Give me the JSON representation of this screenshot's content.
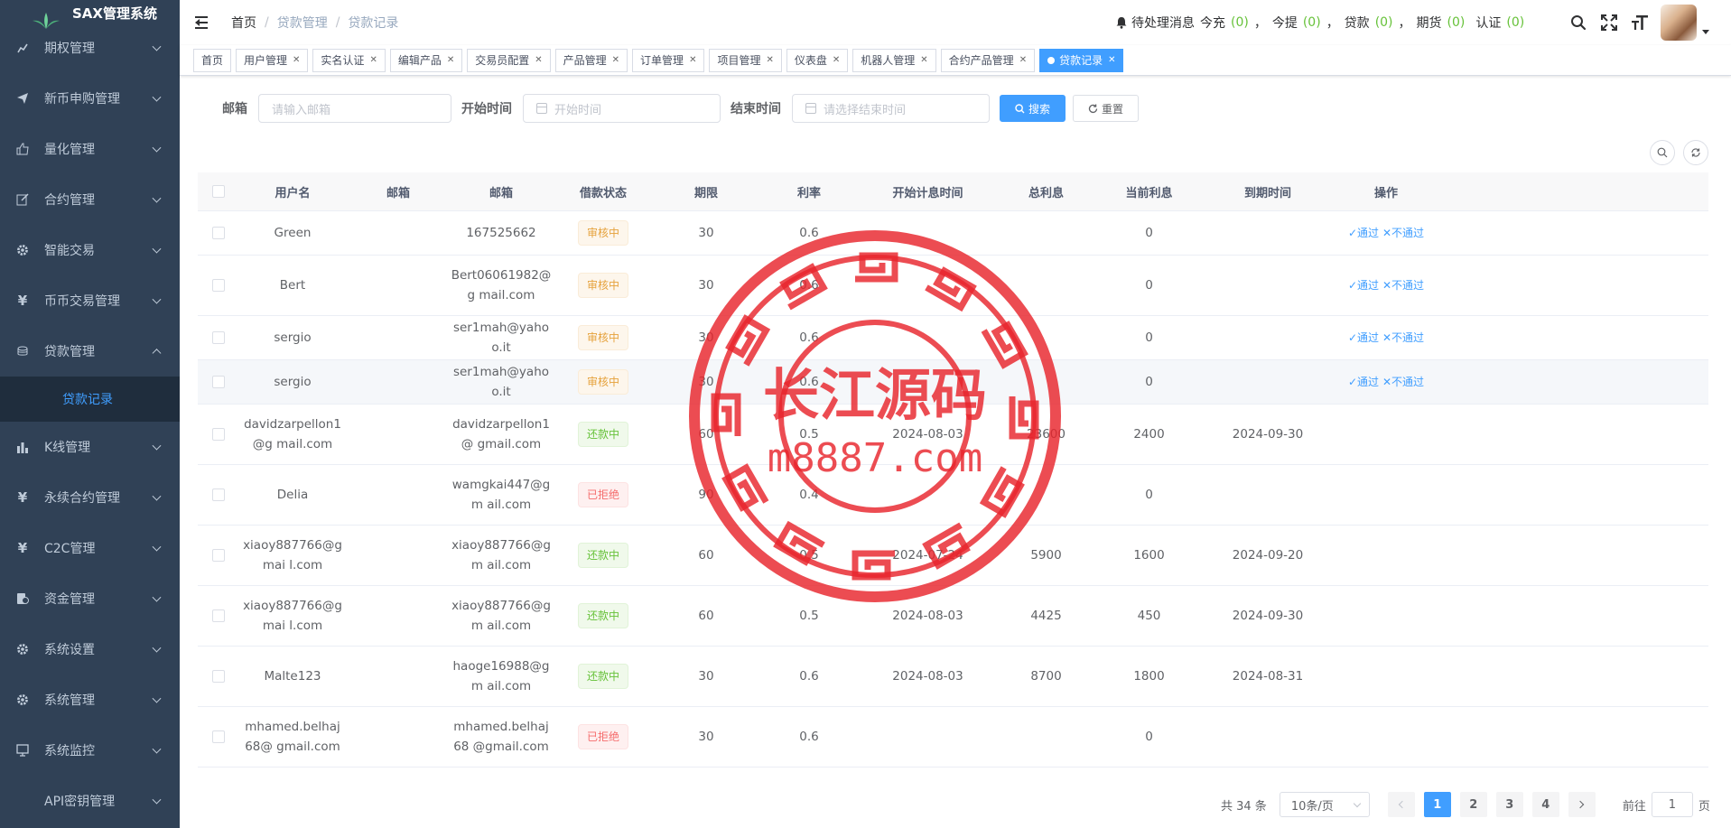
{
  "app": {
    "title": "SAX管理系统"
  },
  "sidebar": {
    "items": [
      {
        "label": "期权管理",
        "icon": "chart-icon"
      },
      {
        "label": "新币申购管理",
        "icon": "send-icon"
      },
      {
        "label": "量化管理",
        "icon": "thumb-icon"
      },
      {
        "label": "合约管理",
        "icon": "edit-icon"
      },
      {
        "label": "智能交易",
        "icon": "gear-icon"
      },
      {
        "label": "币币交易管理",
        "icon": "yen-icon"
      },
      {
        "label": "贷款管理",
        "icon": "coins-icon"
      },
      {
        "label": "K线管理",
        "icon": "bar-chart-icon"
      },
      {
        "label": "永续合约管理",
        "icon": "yen-icon"
      },
      {
        "label": "C2C管理",
        "icon": "yen-icon"
      },
      {
        "label": "资金管理",
        "icon": "money-icon"
      },
      {
        "label": "系统设置",
        "icon": "gear-icon"
      },
      {
        "label": "系统管理",
        "icon": "gear-icon"
      },
      {
        "label": "系统监控",
        "icon": "monitor-icon"
      },
      {
        "label": "API密钥管理",
        "icon": ""
      }
    ],
    "submenu_active": "贷款记录"
  },
  "header": {
    "breadcrumb": [
      "首页",
      "贷款管理",
      "贷款记录"
    ],
    "notice": {
      "label": "待处理消息",
      "items": [
        {
          "label": "今充",
          "count": "(0)"
        },
        {
          "label": "今提",
          "count": "(0)"
        },
        {
          "label": "贷款",
          "count": "(0)"
        },
        {
          "label": "期货",
          "count": "(0)"
        },
        {
          "label": "认证",
          "count": "(0)"
        }
      ],
      "sep": "，"
    }
  },
  "tags": [
    "首页",
    "用户管理",
    "实名认证",
    "编辑产品",
    "交易员配置",
    "产品管理",
    "订单管理",
    "项目管理",
    "仪表盘",
    "机器人管理",
    "合约产品管理",
    "贷款记录"
  ],
  "search": {
    "email_label": "邮箱",
    "email_placeholder": "请输入邮箱",
    "start_label": "开始时间",
    "start_placeholder": "开始时间",
    "end_label": "结束时间",
    "end_placeholder": "请选择结束时间",
    "search_btn": "搜索",
    "reset_btn": "重置"
  },
  "table": {
    "headers": [
      "用户名",
      "邮箱",
      "邮箱",
      "借款状态",
      "期限",
      "利率",
      "开始计息时间",
      "总利息",
      "当前利息",
      "到期时间",
      "操作"
    ],
    "rows": [
      {
        "user": "Green",
        "email": "",
        "email2": "167525662",
        "status": "审核中",
        "status_type": "warn",
        "term": "30",
        "rate": "0.6",
        "start": "",
        "total": "",
        "current": "0",
        "due": "",
        "op": true
      },
      {
        "user": "Bert",
        "email": "",
        "email2": "Bert06061982@g mail.com",
        "status": "审核中",
        "status_type": "warn",
        "term": "30",
        "rate": "0.6",
        "start": "",
        "total": "",
        "current": "0",
        "due": "",
        "op": true
      },
      {
        "user": "sergio",
        "email": "",
        "email2": "ser1mah@yahoo.it",
        "status": "审核中",
        "status_type": "warn",
        "term": "30",
        "rate": "0.6",
        "start": "",
        "total": "",
        "current": "0",
        "due": "",
        "op": true
      },
      {
        "user": "sergio",
        "email": "",
        "email2": "ser1mah@yahoo.it",
        "status": "审核中",
        "status_type": "warn",
        "term": "30",
        "rate": "0.6",
        "start": "",
        "total": "",
        "current": "0",
        "due": "",
        "op": true
      },
      {
        "user": "davidzarpellon1@g mail.com",
        "email": "",
        "email2": "davidzarpellon1@ gmail.com",
        "status": "还款中",
        "status_type": "ok",
        "term": "60",
        "rate": "0.5",
        "start": "2024-08-03",
        "total": "23600",
        "current": "2400",
        "due": "2024-09-30",
        "op": false
      },
      {
        "user": "Delia",
        "email": "",
        "email2": "wamgkai447@gm ail.com",
        "status": "已拒绝",
        "status_type": "err",
        "term": "90",
        "rate": "0.4",
        "start": "",
        "total": "",
        "current": "0",
        "due": "",
        "op": false
      },
      {
        "user": "xiaoy887766@gmai l.com",
        "email": "",
        "email2": "xiaoy887766@gm ail.com",
        "status": "还款中",
        "status_type": "ok",
        "term": "60",
        "rate": "0.5",
        "start": "2024-07-24",
        "total": "5900",
        "current": "1600",
        "due": "2024-09-20",
        "op": false
      },
      {
        "user": "xiaoy887766@gmai l.com",
        "email": "",
        "email2": "xiaoy887766@gm ail.com",
        "status": "还款中",
        "status_type": "ok",
        "term": "60",
        "rate": "0.5",
        "start": "2024-08-03",
        "total": "4425",
        "current": "450",
        "due": "2024-09-30",
        "op": false
      },
      {
        "user": "Malte123",
        "email": "",
        "email2": "haoge16988@gm ail.com",
        "status": "还款中",
        "status_type": "ok",
        "term": "30",
        "rate": "0.6",
        "start": "2024-08-03",
        "total": "8700",
        "current": "1800",
        "due": "2024-08-31",
        "op": false
      },
      {
        "user": "mhamed.belhaj68@ gmail.com",
        "email": "",
        "email2": "mhamed.belhaj68 @gmail.com",
        "status": "已拒绝",
        "status_type": "err",
        "term": "30",
        "rate": "0.6",
        "start": "",
        "total": "",
        "current": "0",
        "due": "",
        "op": false
      }
    ],
    "op_pass": "✓通过",
    "op_reject": "✕不通过"
  },
  "pagination": {
    "total": "共 34 条",
    "page_size": "10条/页",
    "pages": [
      "1",
      "2",
      "3",
      "4"
    ],
    "current": "1",
    "goto_label": "前往",
    "goto_value": "1",
    "page_suffix": "页"
  },
  "watermark": {
    "text1": "长江源码",
    "text2": "m8887.com"
  },
  "colors": {
    "sidebar_bg": "#304156",
    "primary": "#409eff",
    "success": "#67c23a",
    "warning": "#e6a23c",
    "danger": "#f56c6c",
    "stamp": "#e8242c"
  }
}
